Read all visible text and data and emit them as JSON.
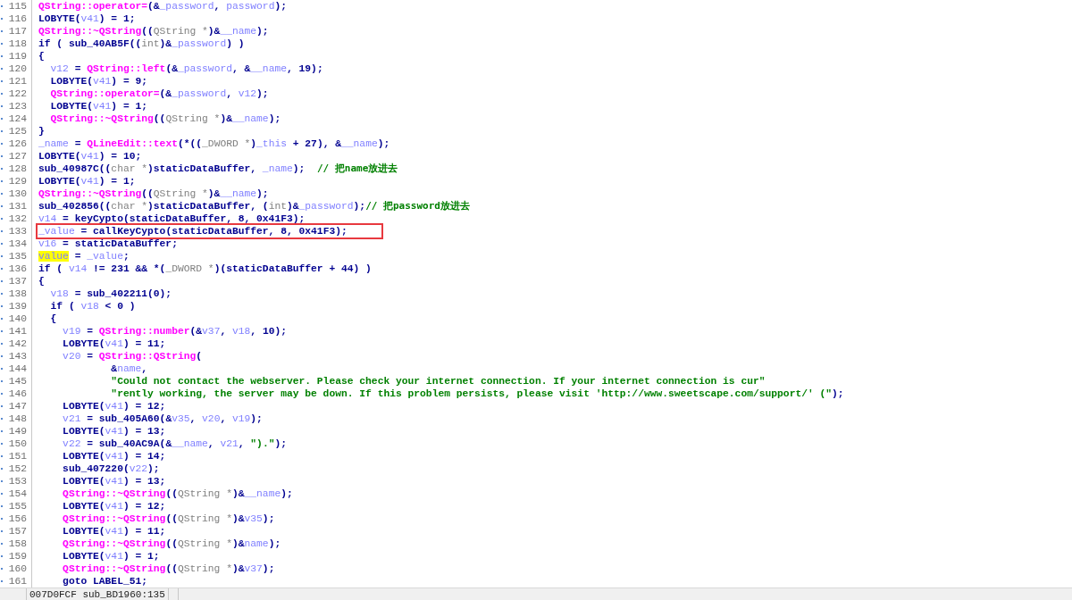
{
  "lines": [
    {
      "num": "115",
      "segments": [
        {
          "text": "QString::operator=",
          "kind": "function"
        },
        {
          "text": "(&",
          "kind": "plain"
        },
        {
          "text": "_password",
          "kind": "variable"
        },
        {
          "text": ", ",
          "kind": "plain"
        },
        {
          "text": "password",
          "kind": "variable"
        },
        {
          "text": ");",
          "kind": "plain"
        }
      ]
    },
    {
      "num": "116",
      "segments": [
        {
          "text": "LOBYTE(",
          "kind": "plain"
        },
        {
          "text": "v41",
          "kind": "variable"
        },
        {
          "text": ") = 1;",
          "kind": "plain"
        }
      ]
    },
    {
      "num": "117",
      "segments": [
        {
          "text": "QString::~QString",
          "kind": "function"
        },
        {
          "text": "((",
          "kind": "plain"
        },
        {
          "text": "QString *",
          "kind": "type"
        },
        {
          "text": ")&",
          "kind": "plain"
        },
        {
          "text": "__name",
          "kind": "variable"
        },
        {
          "text": ");",
          "kind": "plain"
        }
      ]
    },
    {
      "num": "118",
      "segments": [
        {
          "text": "if ( sub_40AB5F((",
          "kind": "plain"
        },
        {
          "text": "int",
          "kind": "type"
        },
        {
          "text": ")&",
          "kind": "plain"
        },
        {
          "text": "_password",
          "kind": "variable"
        },
        {
          "text": ") )",
          "kind": "plain"
        }
      ]
    },
    {
      "num": "119",
      "segments": [
        {
          "text": "{",
          "kind": "plain"
        }
      ]
    },
    {
      "num": "120",
      "segments": [
        {
          "text": "  v12",
          "kind": "variable"
        },
        {
          "text": " = ",
          "kind": "plain"
        },
        {
          "text": "QString::left",
          "kind": "function"
        },
        {
          "text": "(&",
          "kind": "plain"
        },
        {
          "text": "_password",
          "kind": "variable"
        },
        {
          "text": ", &",
          "kind": "plain"
        },
        {
          "text": "__name",
          "kind": "variable"
        },
        {
          "text": ", 19);",
          "kind": "plain"
        }
      ]
    },
    {
      "num": "121",
      "segments": [
        {
          "text": "  LOBYTE(",
          "kind": "plain"
        },
        {
          "text": "v41",
          "kind": "variable"
        },
        {
          "text": ") = 9;",
          "kind": "plain"
        }
      ]
    },
    {
      "num": "122",
      "segments": [
        {
          "text": "  QString::operator=",
          "kind": "function"
        },
        {
          "text": "(&",
          "kind": "plain"
        },
        {
          "text": "_password",
          "kind": "variable"
        },
        {
          "text": ", ",
          "kind": "plain"
        },
        {
          "text": "v12",
          "kind": "variable"
        },
        {
          "text": ");",
          "kind": "plain"
        }
      ]
    },
    {
      "num": "123",
      "segments": [
        {
          "text": "  LOBYTE(",
          "kind": "plain"
        },
        {
          "text": "v41",
          "kind": "variable"
        },
        {
          "text": ") = 1;",
          "kind": "plain"
        }
      ]
    },
    {
      "num": "124",
      "segments": [
        {
          "text": "  QString::~QString",
          "kind": "function"
        },
        {
          "text": "((",
          "kind": "plain"
        },
        {
          "text": "QString *",
          "kind": "type"
        },
        {
          "text": ")&",
          "kind": "plain"
        },
        {
          "text": "__name",
          "kind": "variable"
        },
        {
          "text": ");",
          "kind": "plain"
        }
      ]
    },
    {
      "num": "125",
      "segments": [
        {
          "text": "}",
          "kind": "plain"
        }
      ]
    },
    {
      "num": "126",
      "segments": [
        {
          "text": "_name",
          "kind": "variable"
        },
        {
          "text": " = ",
          "kind": "plain"
        },
        {
          "text": "QLineEdit::text",
          "kind": "function"
        },
        {
          "text": "(*((",
          "kind": "plain"
        },
        {
          "text": "_DWORD *",
          "kind": "type"
        },
        {
          "text": ")",
          "kind": "plain"
        },
        {
          "text": "_this",
          "kind": "variable"
        },
        {
          "text": " + 27), &",
          "kind": "plain"
        },
        {
          "text": "__name",
          "kind": "variable"
        },
        {
          "text": ");",
          "kind": "plain"
        }
      ]
    },
    {
      "num": "127",
      "segments": [
        {
          "text": "LOBYTE(",
          "kind": "plain"
        },
        {
          "text": "v41",
          "kind": "variable"
        },
        {
          "text": ") = 10;",
          "kind": "plain"
        }
      ]
    },
    {
      "num": "128",
      "segments": [
        {
          "text": "sub_40987C((",
          "kind": "plain"
        },
        {
          "text": "char *",
          "kind": "type"
        },
        {
          "text": ")staticDataBuffer, ",
          "kind": "plain"
        },
        {
          "text": "_name",
          "kind": "variable"
        },
        {
          "text": ");  ",
          "kind": "plain"
        },
        {
          "text": "// 把name放进去",
          "kind": "comment"
        }
      ]
    },
    {
      "num": "129",
      "segments": [
        {
          "text": "LOBYTE(",
          "kind": "plain"
        },
        {
          "text": "v41",
          "kind": "variable"
        },
        {
          "text": ") = 1;",
          "kind": "plain"
        }
      ]
    },
    {
      "num": "130",
      "segments": [
        {
          "text": "QString::~QString",
          "kind": "function"
        },
        {
          "text": "((",
          "kind": "plain"
        },
        {
          "text": "QString *",
          "kind": "type"
        },
        {
          "text": ")&",
          "kind": "plain"
        },
        {
          "text": "__name",
          "kind": "variable"
        },
        {
          "text": ");",
          "kind": "plain"
        }
      ]
    },
    {
      "num": "131",
      "segments": [
        {
          "text": "sub_402856((",
          "kind": "plain"
        },
        {
          "text": "char *",
          "kind": "type"
        },
        {
          "text": ")staticDataBuffer, (",
          "kind": "plain"
        },
        {
          "text": "int",
          "kind": "type"
        },
        {
          "text": ")&",
          "kind": "plain"
        },
        {
          "text": "_password",
          "kind": "variable"
        },
        {
          "text": ");",
          "kind": "plain"
        },
        {
          "text": "// 把password放进去",
          "kind": "comment"
        }
      ]
    },
    {
      "num": "132",
      "segments": [
        {
          "text": "v14",
          "kind": "variable"
        },
        {
          "text": " = keyCypto(staticDataBuffer, 8, 0x41F3);",
          "kind": "plain"
        }
      ]
    },
    {
      "num": "133",
      "boxed": true,
      "segments": [
        {
          "text": "_value",
          "kind": "variable"
        },
        {
          "text": " = callKeyCypto(staticDataBuffer, 8, 0x41F3);",
          "kind": "plain"
        }
      ]
    },
    {
      "num": "134",
      "segments": [
        {
          "text": "v16",
          "kind": "variable"
        },
        {
          "text": " = staticDataBuffer;",
          "kind": "plain"
        }
      ]
    },
    {
      "num": "135",
      "segments": [
        {
          "text": "value",
          "kind": "highlight"
        },
        {
          "text": " = ",
          "kind": "plain"
        },
        {
          "text": "_value",
          "kind": "variable"
        },
        {
          "text": ";",
          "kind": "plain"
        }
      ]
    },
    {
      "num": "136",
      "segments": [
        {
          "text": "if ( ",
          "kind": "plain"
        },
        {
          "text": "v14",
          "kind": "variable"
        },
        {
          "text": " != 231 && *(",
          "kind": "plain"
        },
        {
          "text": "_DWORD *",
          "kind": "type"
        },
        {
          "text": ")(staticDataBuffer + 44) )",
          "kind": "plain"
        }
      ]
    },
    {
      "num": "137",
      "segments": [
        {
          "text": "{",
          "kind": "plain"
        }
      ]
    },
    {
      "num": "138",
      "segments": [
        {
          "text": "  v18",
          "kind": "variable"
        },
        {
          "text": " = sub_402211(0);",
          "kind": "plain"
        }
      ]
    },
    {
      "num": "139",
      "segments": [
        {
          "text": "  if ( ",
          "kind": "plain"
        },
        {
          "text": "v18",
          "kind": "variable"
        },
        {
          "text": " < 0 )",
          "kind": "plain"
        }
      ]
    },
    {
      "num": "140",
      "segments": [
        {
          "text": "  {",
          "kind": "plain"
        }
      ]
    },
    {
      "num": "141",
      "segments": [
        {
          "text": "    v19",
          "kind": "variable"
        },
        {
          "text": " = ",
          "kind": "plain"
        },
        {
          "text": "QString::number",
          "kind": "function"
        },
        {
          "text": "(&",
          "kind": "plain"
        },
        {
          "text": "v37",
          "kind": "variable"
        },
        {
          "text": ", ",
          "kind": "plain"
        },
        {
          "text": "v18",
          "kind": "variable"
        },
        {
          "text": ", 10);",
          "kind": "plain"
        }
      ]
    },
    {
      "num": "142",
      "segments": [
        {
          "text": "    LOBYTE(",
          "kind": "plain"
        },
        {
          "text": "v41",
          "kind": "variable"
        },
        {
          "text": ") = 11;",
          "kind": "plain"
        }
      ]
    },
    {
      "num": "143",
      "segments": [
        {
          "text": "    v20",
          "kind": "variable"
        },
        {
          "text": " = ",
          "kind": "plain"
        },
        {
          "text": "QString::QString",
          "kind": "function"
        },
        {
          "text": "(",
          "kind": "plain"
        }
      ]
    },
    {
      "num": "144",
      "segments": [
        {
          "text": "            &",
          "kind": "plain"
        },
        {
          "text": "name",
          "kind": "variable"
        },
        {
          "text": ",",
          "kind": "plain"
        }
      ]
    },
    {
      "num": "145",
      "segments": [
        {
          "text": "            \"Could not contact the webserver. Please check your internet connection. If your internet connection is cur\"",
          "kind": "string"
        }
      ]
    },
    {
      "num": "146",
      "segments": [
        {
          "text": "            \"rently working, the server may be down. If this problem persists, please visit 'http://www.sweetscape.com/support/' (\"",
          "kind": "string"
        },
        {
          "text": ");",
          "kind": "plain"
        }
      ]
    },
    {
      "num": "147",
      "segments": [
        {
          "text": "    LOBYTE(",
          "kind": "plain"
        },
        {
          "text": "v41",
          "kind": "variable"
        },
        {
          "text": ") = 12;",
          "kind": "plain"
        }
      ]
    },
    {
      "num": "148",
      "segments": [
        {
          "text": "    v21",
          "kind": "variable"
        },
        {
          "text": " = sub_405A60(&",
          "kind": "plain"
        },
        {
          "text": "v35",
          "kind": "variable"
        },
        {
          "text": ", ",
          "kind": "plain"
        },
        {
          "text": "v20",
          "kind": "variable"
        },
        {
          "text": ", ",
          "kind": "plain"
        },
        {
          "text": "v19",
          "kind": "variable"
        },
        {
          "text": ");",
          "kind": "plain"
        }
      ]
    },
    {
      "num": "149",
      "segments": [
        {
          "text": "    LOBYTE(",
          "kind": "plain"
        },
        {
          "text": "v41",
          "kind": "variable"
        },
        {
          "text": ") = 13;",
          "kind": "plain"
        }
      ]
    },
    {
      "num": "150",
      "segments": [
        {
          "text": "    v22",
          "kind": "variable"
        },
        {
          "text": " = sub_40AC9A(&",
          "kind": "plain"
        },
        {
          "text": "__name",
          "kind": "variable"
        },
        {
          "text": ", ",
          "kind": "plain"
        },
        {
          "text": "v21",
          "kind": "variable"
        },
        {
          "text": ", ",
          "kind": "plain"
        },
        {
          "text": "\").\"",
          "kind": "string"
        },
        {
          "text": ");",
          "kind": "plain"
        }
      ]
    },
    {
      "num": "151",
      "segments": [
        {
          "text": "    LOBYTE(",
          "kind": "plain"
        },
        {
          "text": "v41",
          "kind": "variable"
        },
        {
          "text": ") = 14;",
          "kind": "plain"
        }
      ]
    },
    {
      "num": "152",
      "segments": [
        {
          "text": "    sub_407220(",
          "kind": "plain"
        },
        {
          "text": "v22",
          "kind": "variable"
        },
        {
          "text": ");",
          "kind": "plain"
        }
      ]
    },
    {
      "num": "153",
      "segments": [
        {
          "text": "    LOBYTE(",
          "kind": "plain"
        },
        {
          "text": "v41",
          "kind": "variable"
        },
        {
          "text": ") = 13;",
          "kind": "plain"
        }
      ]
    },
    {
      "num": "154",
      "segments": [
        {
          "text": "    QString::~QString",
          "kind": "function"
        },
        {
          "text": "((",
          "kind": "plain"
        },
        {
          "text": "QString *",
          "kind": "type"
        },
        {
          "text": ")&",
          "kind": "plain"
        },
        {
          "text": "__name",
          "kind": "variable"
        },
        {
          "text": ");",
          "kind": "plain"
        }
      ]
    },
    {
      "num": "155",
      "segments": [
        {
          "text": "    LOBYTE(",
          "kind": "plain"
        },
        {
          "text": "v41",
          "kind": "variable"
        },
        {
          "text": ") = 12;",
          "kind": "plain"
        }
      ]
    },
    {
      "num": "156",
      "segments": [
        {
          "text": "    QString::~QString",
          "kind": "function"
        },
        {
          "text": "((",
          "kind": "plain"
        },
        {
          "text": "QString *",
          "kind": "type"
        },
        {
          "text": ")&",
          "kind": "plain"
        },
        {
          "text": "v35",
          "kind": "variable"
        },
        {
          "text": ");",
          "kind": "plain"
        }
      ]
    },
    {
      "num": "157",
      "segments": [
        {
          "text": "    LOBYTE(",
          "kind": "plain"
        },
        {
          "text": "v41",
          "kind": "variable"
        },
        {
          "text": ") = 11;",
          "kind": "plain"
        }
      ]
    },
    {
      "num": "158",
      "segments": [
        {
          "text": "    QString::~QString",
          "kind": "function"
        },
        {
          "text": "((",
          "kind": "plain"
        },
        {
          "text": "QString *",
          "kind": "type"
        },
        {
          "text": ")&",
          "kind": "plain"
        },
        {
          "text": "name",
          "kind": "variable"
        },
        {
          "text": ");",
          "kind": "plain"
        }
      ]
    },
    {
      "num": "159",
      "segments": [
        {
          "text": "    LOBYTE(",
          "kind": "plain"
        },
        {
          "text": "v41",
          "kind": "variable"
        },
        {
          "text": ") = 1;",
          "kind": "plain"
        }
      ]
    },
    {
      "num": "160",
      "segments": [
        {
          "text": "    QString::~QString",
          "kind": "function"
        },
        {
          "text": "((",
          "kind": "plain"
        },
        {
          "text": "QString *",
          "kind": "type"
        },
        {
          "text": ")&",
          "kind": "plain"
        },
        {
          "text": "v37",
          "kind": "variable"
        },
        {
          "text": ");",
          "kind": "plain"
        }
      ]
    },
    {
      "num": "161",
      "segments": [
        {
          "text": "    goto LABEL_51;",
          "kind": "plain"
        }
      ]
    }
  ],
  "status_bar": {
    "location": "007D0FCF sub_BD1960:135"
  }
}
